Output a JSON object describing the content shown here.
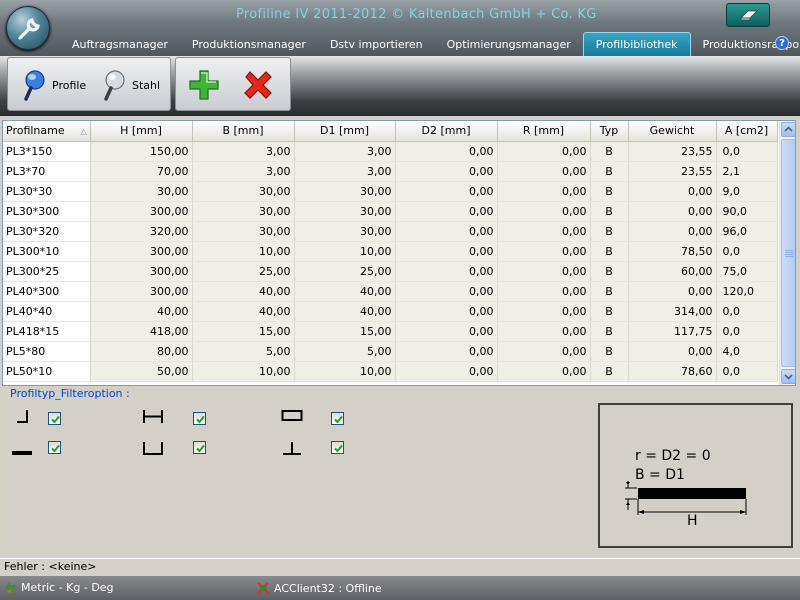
{
  "header": {
    "title": "Profiline IV 2011-2012 © Kaltenbach GmbH + Co. KG",
    "tabs": [
      {
        "label": "Auftragsmanager"
      },
      {
        "label": "Produktionsmanager"
      },
      {
        "label": "Dstv importieren"
      },
      {
        "label": "Optimierungsmanager"
      },
      {
        "label": "Profilbibliothek",
        "active": true
      },
      {
        "label": "Produktionsrapport"
      }
    ],
    "help_label": "?"
  },
  "toolbar": {
    "profile_label": "Profile",
    "stahl_label": "Stahl",
    "add_icon": "plus-icon",
    "delete_icon": "x-icon"
  },
  "grid": {
    "columns": [
      "Profilname",
      "H [mm]",
      "B [mm]",
      "D1 [mm]",
      "D2 [mm]",
      "R [mm]",
      "Typ",
      "Gewicht",
      "A [cm2]"
    ],
    "rows": [
      [
        "PL3*150",
        "150,00",
        "3,00",
        "3,00",
        "0,00",
        "0,00",
        "B",
        "23,55",
        "0,0"
      ],
      [
        "PL3*70",
        "70,00",
        "3,00",
        "3,00",
        "0,00",
        "0,00",
        "B",
        "23,55",
        "2,1"
      ],
      [
        "PL30*30",
        "30,00",
        "30,00",
        "30,00",
        "0,00",
        "0,00",
        "B",
        "0,00",
        "9,0"
      ],
      [
        "PL30*300",
        "300,00",
        "30,00",
        "30,00",
        "0,00",
        "0,00",
        "B",
        "0,00",
        "90,0"
      ],
      [
        "PL30*320",
        "320,00",
        "30,00",
        "30,00",
        "0,00",
        "0,00",
        "B",
        "0,00",
        "96,0"
      ],
      [
        "PL300*10",
        "300,00",
        "10,00",
        "10,00",
        "0,00",
        "0,00",
        "B",
        "78,50",
        "0,0"
      ],
      [
        "PL300*25",
        "300,00",
        "25,00",
        "25,00",
        "0,00",
        "0,00",
        "B",
        "60,00",
        "75,0"
      ],
      [
        "PL40*300",
        "300,00",
        "40,00",
        "40,00",
        "0,00",
        "0,00",
        "B",
        "0,00",
        "120,0"
      ],
      [
        "PL40*40",
        "40,00",
        "40,00",
        "40,00",
        "0,00",
        "0,00",
        "B",
        "314,00",
        "0,0"
      ],
      [
        "PL418*15",
        "418,00",
        "15,00",
        "15,00",
        "0,00",
        "0,00",
        "B",
        "117,75",
        "0,0"
      ],
      [
        "PL5*80",
        "80,00",
        "5,00",
        "5,00",
        "0,00",
        "0,00",
        "B",
        "0,00",
        "4,0"
      ],
      [
        "PL50*10",
        "50,00",
        "10,00",
        "10,00",
        "0,00",
        "0,00",
        "B",
        "78,60",
        "0,0"
      ]
    ]
  },
  "filter": {
    "title": "Profiltyp_Filteroption :",
    "options": [
      {
        "shape": "angle-profile-icon",
        "checked": true
      },
      {
        "shape": "i-beam-profile-icon",
        "checked": true
      },
      {
        "shape": "rect-tube-profile-icon",
        "checked": true
      },
      {
        "shape": "flat-bar-profile-icon",
        "checked": true
      },
      {
        "shape": "channel-profile-icon",
        "checked": true
      },
      {
        "shape": "t-profile-icon",
        "checked": true
      }
    ]
  },
  "preview": {
    "line1": "r = D2 = 0",
    "line2": "B = D1",
    "dim_label": "H"
  },
  "status": {
    "error_text": "Fehler : <keine>",
    "units": "Metric - Kg - Deg",
    "client": "ACClient32 : Offline"
  }
}
